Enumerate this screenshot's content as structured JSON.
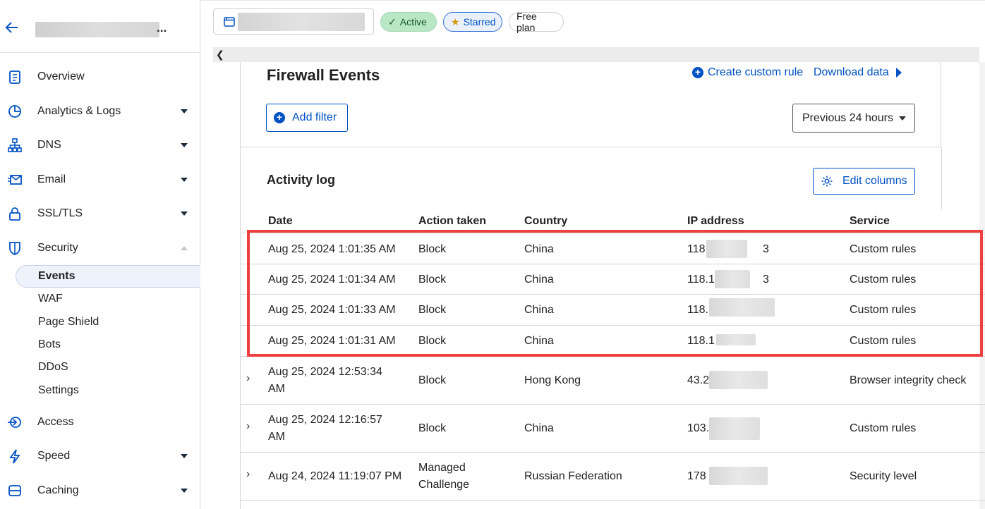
{
  "sidebar": {
    "account_suffix": "...",
    "items": [
      {
        "label": "Overview",
        "icon": "clipboard-icon"
      },
      {
        "label": "Analytics & Logs",
        "icon": "pie-chart-icon"
      },
      {
        "label": "DNS",
        "icon": "network-icon"
      },
      {
        "label": "Email",
        "icon": "email-icon"
      },
      {
        "label": "SSL/TLS",
        "icon": "lock-icon"
      },
      {
        "label": "Security",
        "icon": "shield-icon"
      },
      {
        "label": "Access",
        "icon": "access-icon"
      },
      {
        "label": "Speed",
        "icon": "lightning-icon"
      },
      {
        "label": "Caching",
        "icon": "storage-icon"
      }
    ],
    "security_sub": [
      "Events",
      "WAF",
      "Page Shield",
      "Bots",
      "DDoS",
      "Settings"
    ]
  },
  "topbar": {
    "active_label": "Active",
    "starred_label": "Starred",
    "plan_label": "Free plan"
  },
  "firewall": {
    "title": "Firewall Events",
    "create_rule": "Create custom rule",
    "download": "Download data",
    "add_filter": "Add filter",
    "timerange": "Previous 24 hours"
  },
  "activity": {
    "title": "Activity log",
    "edit_columns": "Edit columns",
    "columns": [
      "Date",
      "Action taken",
      "Country",
      "IP address",
      "Service"
    ],
    "rows": [
      {
        "date": "Aug 25, 2024 1:01:35 AM",
        "action": "Block",
        "country": "China",
        "ip": "118",
        "ip_tail": "3",
        "service": "Custom rules"
      },
      {
        "date": "Aug 25, 2024 1:01:34 AM",
        "action": "Block",
        "country": "China",
        "ip": "118.1",
        "ip_tail": "3",
        "service": "Custom rules"
      },
      {
        "date": "Aug 25, 2024 1:01:33 AM",
        "action": "Block",
        "country": "China",
        "ip": "118.",
        "ip_tail": "",
        "service": "Custom rules"
      },
      {
        "date": "Aug 25, 2024 1:01:31 AM",
        "action": "Block",
        "country": "China",
        "ip": "118.1",
        "ip_tail": "",
        "service": "Custom rules"
      },
      {
        "date_l1": "Aug 25, 2024 12:53:34",
        "date_l2": "AM",
        "action": "Block",
        "country": "Hong Kong",
        "ip": "43.2",
        "service": "Browser integrity check"
      },
      {
        "date_l1": "Aug 25, 2024 12:16:57",
        "date_l2": "AM",
        "action": "Block",
        "country": "China",
        "ip": "103.",
        "service": "Custom rules"
      },
      {
        "date": "Aug 24, 2024 11:19:07 PM",
        "action_l1": "Managed",
        "action_l2": "Challenge",
        "country": "Russian Federation",
        "ip": "178",
        "service": "Security level"
      }
    ]
  },
  "colors": {
    "accent": "#0051c3",
    "highlight": "#ee4040",
    "active_pill": "#b9e6c4"
  }
}
